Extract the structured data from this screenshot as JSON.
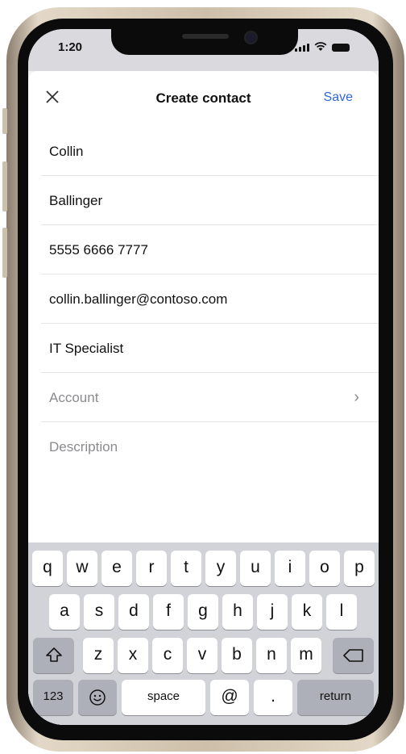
{
  "status_bar": {
    "time": "1:20"
  },
  "header": {
    "title": "Create contact",
    "save_label": "Save",
    "close_icon": "close-icon"
  },
  "fields": [
    {
      "value": "Collin"
    },
    {
      "value": "Ballinger"
    },
    {
      "value": "5555 6666 7777"
    },
    {
      "value": "collin.ballinger@contoso.com"
    },
    {
      "value": "IT Specialist"
    }
  ],
  "account": {
    "placeholder": "Account",
    "icon": "chevron-right-icon"
  },
  "description": {
    "placeholder": "Description"
  },
  "keyboard": {
    "row1": [
      "q",
      "w",
      "e",
      "r",
      "t",
      "y",
      "u",
      "i",
      "o",
      "p"
    ],
    "row2": [
      "a",
      "s",
      "d",
      "f",
      "g",
      "h",
      "j",
      "k",
      "l"
    ],
    "row3": [
      "z",
      "x",
      "c",
      "v",
      "b",
      "n",
      "m"
    ],
    "numbers_label": "123",
    "space_label": "space",
    "at_label": "@",
    "dot_label": ".",
    "return_label": "return",
    "shift_icon": "shift-icon",
    "delete_icon": "delete-icon",
    "emoji_icon": "emoji-icon"
  }
}
